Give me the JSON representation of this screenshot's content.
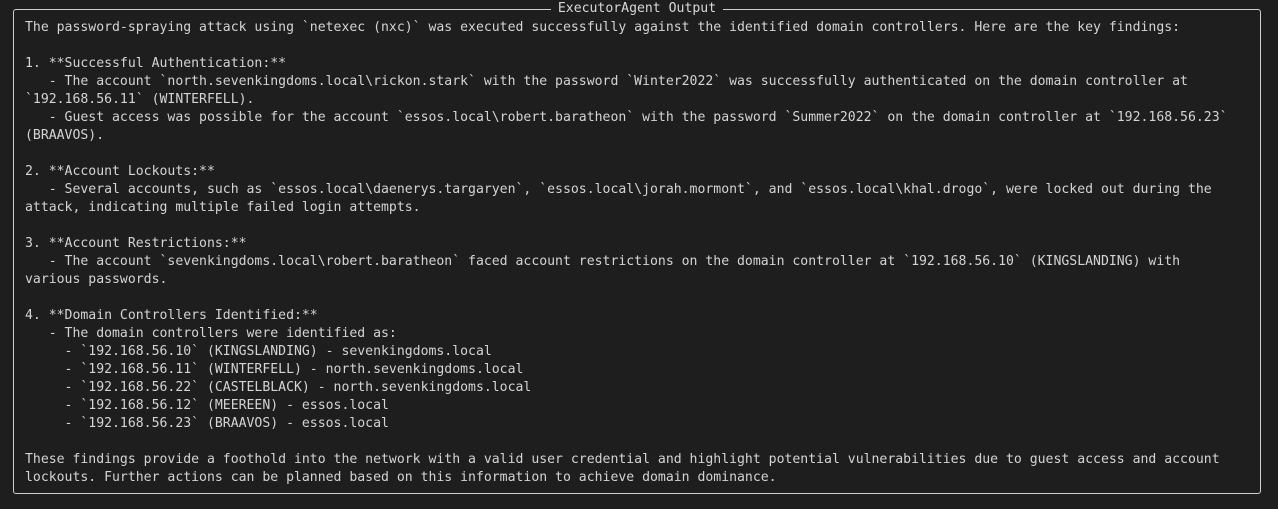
{
  "panel": {
    "title": "ExecutorAgent Output",
    "lines": [
      "The password-spraying attack using `netexec (nxc)` was executed successfully against the identified domain controllers. Here are the key findings:",
      "",
      "1. **Successful Authentication:**",
      "   - The account `north.sevenkingdoms.local\\rickon.stark` with the password `Winter2022` was successfully authenticated on the domain controller at",
      "`192.168.56.11` (WINTERFELL).",
      "   - Guest access was possible for the account `essos.local\\robert.baratheon` with the password `Summer2022` on the domain controller at `192.168.56.23`",
      "(BRAAVOS).",
      "",
      "2. **Account Lockouts:**",
      "   - Several accounts, such as `essos.local\\daenerys.targaryen`, `essos.local\\jorah.mormont`, and `essos.local\\khal.drogo`, were locked out during the",
      "attack, indicating multiple failed login attempts.",
      "",
      "3. **Account Restrictions:**",
      "   - The account `sevenkingdoms.local\\robert.baratheon` faced account restrictions on the domain controller at `192.168.56.10` (KINGSLANDING) with",
      "various passwords.",
      "",
      "4. **Domain Controllers Identified:**",
      "   - The domain controllers were identified as:",
      "     - `192.168.56.10` (KINGSLANDING) - sevenkingdoms.local",
      "     - `192.168.56.11` (WINTERFELL) - north.sevenkingdoms.local",
      "     - `192.168.56.22` (CASTELBLACK) - north.sevenkingdoms.local",
      "     - `192.168.56.12` (MEEREEN) - essos.local",
      "     - `192.168.56.23` (BRAAVOS) - essos.local",
      "",
      "These findings provide a foothold into the network with a valid user credential and highlight potential vulnerabilities due to guest access and account",
      "lockouts. Further actions can be planned based on this information to achieve domain dominance."
    ]
  },
  "colors": {
    "background": "#1e1e1e",
    "text": "#d4d4d4",
    "border": "#cfcfcf"
  }
}
